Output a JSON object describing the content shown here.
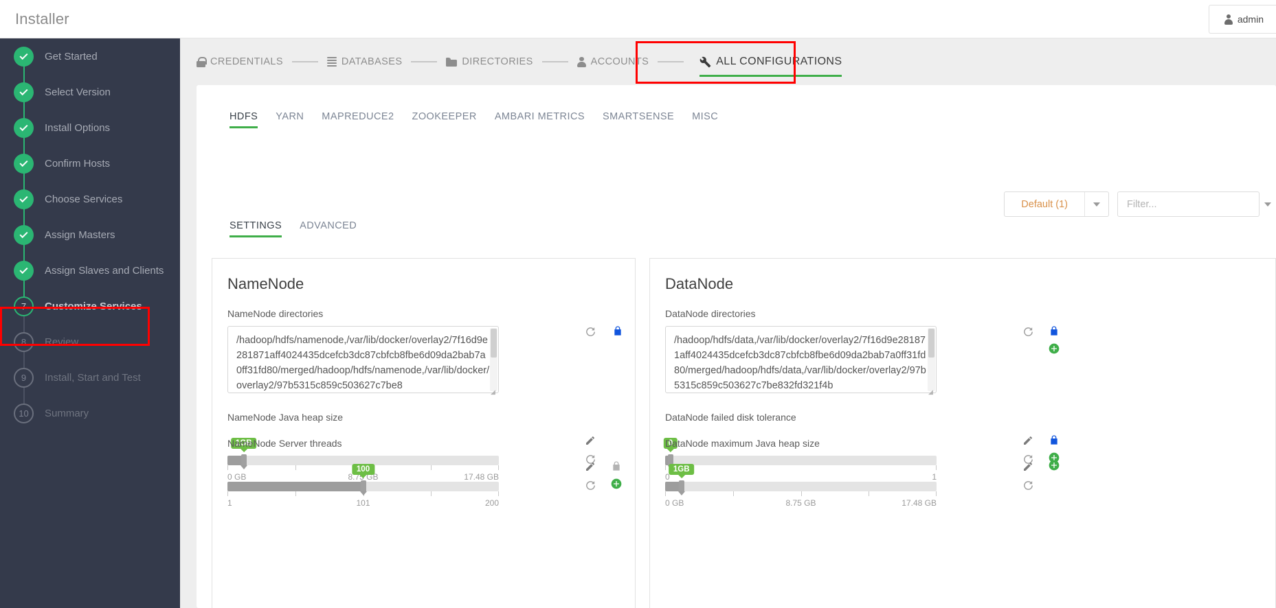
{
  "header": {
    "app_title": "Installer",
    "user_name": "admin",
    "user_icon": "person-icon"
  },
  "sidebar": {
    "steps": [
      {
        "num": "1",
        "label": "Get Started",
        "state": "done"
      },
      {
        "num": "2",
        "label": "Select Version",
        "state": "done"
      },
      {
        "num": "3",
        "label": "Install Options",
        "state": "done"
      },
      {
        "num": "4",
        "label": "Confirm Hosts",
        "state": "done"
      },
      {
        "num": "5",
        "label": "Choose Services",
        "state": "done"
      },
      {
        "num": "6",
        "label": "Assign Masters",
        "state": "done"
      },
      {
        "num": "7",
        "label": "Assign Slaves and Clients",
        "state": "done"
      },
      {
        "num": "7",
        "label": "Customize Services",
        "state": "current"
      },
      {
        "num": "8",
        "label": "Review",
        "state": "todo"
      },
      {
        "num": "9",
        "label": "Install, Start and Test",
        "state": "todo"
      },
      {
        "num": "10",
        "label": "Summary",
        "state": "todo"
      }
    ]
  },
  "wizard_nav": {
    "items": [
      {
        "label": "CREDENTIALS",
        "icon": "lock-icon",
        "active": false
      },
      {
        "label": "DATABASES",
        "icon": "database-icon",
        "active": false
      },
      {
        "label": "DIRECTORIES",
        "icon": "folder-icon",
        "active": false
      },
      {
        "label": "ACCOUNTS",
        "icon": "person-icon",
        "active": false
      },
      {
        "label": "ALL CONFIGURATIONS",
        "icon": "wrench-icon",
        "active": true
      }
    ],
    "highlight_color": "#ff0000",
    "active_underline_color": "#3fae49"
  },
  "service_tabs": [
    {
      "label": "HDFS",
      "active": true
    },
    {
      "label": "YARN",
      "active": false
    },
    {
      "label": "MAPREDUCE2",
      "active": false
    },
    {
      "label": "ZOOKEEPER",
      "active": false
    },
    {
      "label": "AMBARI METRICS",
      "active": false
    },
    {
      "label": "SMARTSENSE",
      "active": false
    },
    {
      "label": "MISC",
      "active": false
    }
  ],
  "toolbar": {
    "group_dropdown_label": "Default (1)",
    "group_dropdown_color": "#d9914a",
    "filter_placeholder": "Filter...",
    "filter_value": ""
  },
  "settings_tabs": [
    {
      "label": "SETTINGS",
      "active": true
    },
    {
      "label": "ADVANCED",
      "active": false
    }
  ],
  "panels": {
    "namenode": {
      "title": "NameNode",
      "directories": {
        "label": "NameNode directories",
        "value": "/hadoop/hdfs/namenode,/var/lib/docker/overlay2/7f16d9e281871aff4024435dcefcb3dc87cbfcb8fbe6d09da2bab7a0ff31fd80/merged/hadoop/hdfs/namenode,/var/lib/docker/overlay2/97b5315c859c503627c7be8"
      },
      "heap": {
        "label": "NameNode Java heap size",
        "value": "1GB",
        "min_label": "0 GB",
        "mid_label": "8.75 GB",
        "max_label": "17.48 GB",
        "percent": 6
      },
      "threads": {
        "label": "NameNode Server threads",
        "value": "100",
        "min_label": "1",
        "mid_label": "101",
        "max_label": "200",
        "percent": 50
      }
    },
    "datanode": {
      "title": "DataNode",
      "directories": {
        "label": "DataNode directories",
        "value": "/hadoop/hdfs/data,/var/lib/docker/overlay2/7f16d9e281871aff4024435dcefcb3dc87cbfcb8fbe6d09da2bab7a0ff31fd80/merged/hadoop/hdfs/data,/var/lib/docker/overlay2/97b5315c859c503627c7be832fd321f4b"
      },
      "failed_disk": {
        "label": "DataNode failed disk tolerance",
        "value": "0",
        "min_label": "0",
        "mid_label": "",
        "max_label": "1",
        "percent": 2
      },
      "max_heap": {
        "label": "DataNode maximum Java heap size",
        "value": "1GB",
        "min_label": "0 GB",
        "mid_label": "8.75 GB",
        "max_label": "17.48 GB",
        "percent": 6
      }
    }
  },
  "icons": {
    "refresh": "refresh-icon",
    "pencil": "pencil-icon",
    "lock_locked": "lock-icon",
    "plus": "plus-circle-icon"
  }
}
